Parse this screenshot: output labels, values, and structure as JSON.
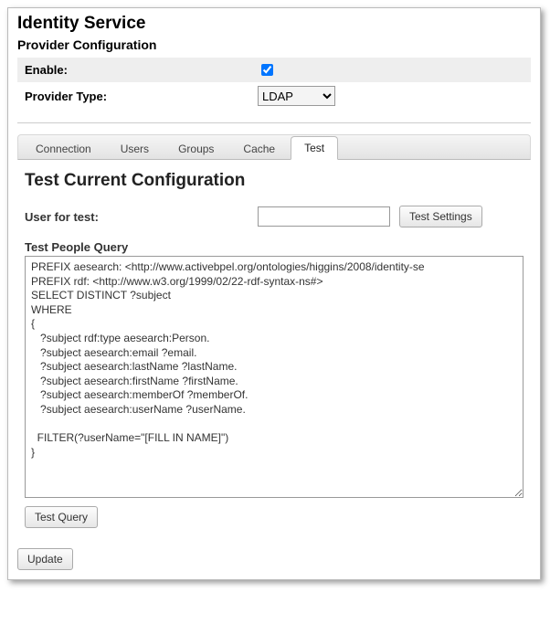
{
  "header": {
    "title": "Identity Service",
    "section": "Provider Configuration"
  },
  "form": {
    "enable_label": "Enable:",
    "enable_checked": true,
    "provider_type_label": "Provider Type:",
    "provider_type_value": "LDAP"
  },
  "tabs": [
    {
      "id": "connection",
      "label": "Connection",
      "active": false
    },
    {
      "id": "users",
      "label": "Users",
      "active": false
    },
    {
      "id": "groups",
      "label": "Groups",
      "active": false
    },
    {
      "id": "cache",
      "label": "Cache",
      "active": false
    },
    {
      "id": "test",
      "label": "Test",
      "active": true
    }
  ],
  "test_panel": {
    "heading": "Test Current Configuration",
    "user_label": "User for test:",
    "user_value": "",
    "test_settings_label": "Test Settings",
    "query_label": "Test People Query",
    "query_value": "PREFIX aesearch: <http://www.activebpel.org/ontologies/higgins/2008/identity-se\nPREFIX rdf: <http://www.w3.org/1999/02/22-rdf-syntax-ns#>\nSELECT DISTINCT ?subject\nWHERE\n{\n   ?subject rdf:type aesearch:Person.\n   ?subject aesearch:email ?email.\n   ?subject aesearch:lastName ?lastName.\n   ?subject aesearch:firstName ?firstName.\n   ?subject aesearch:memberOf ?memberOf.\n   ?subject aesearch:userName ?userName.\n\n  FILTER(?userName=\"[FILL IN NAME]\")\n}",
    "test_query_label": "Test Query"
  },
  "footer": {
    "update_label": "Update"
  }
}
